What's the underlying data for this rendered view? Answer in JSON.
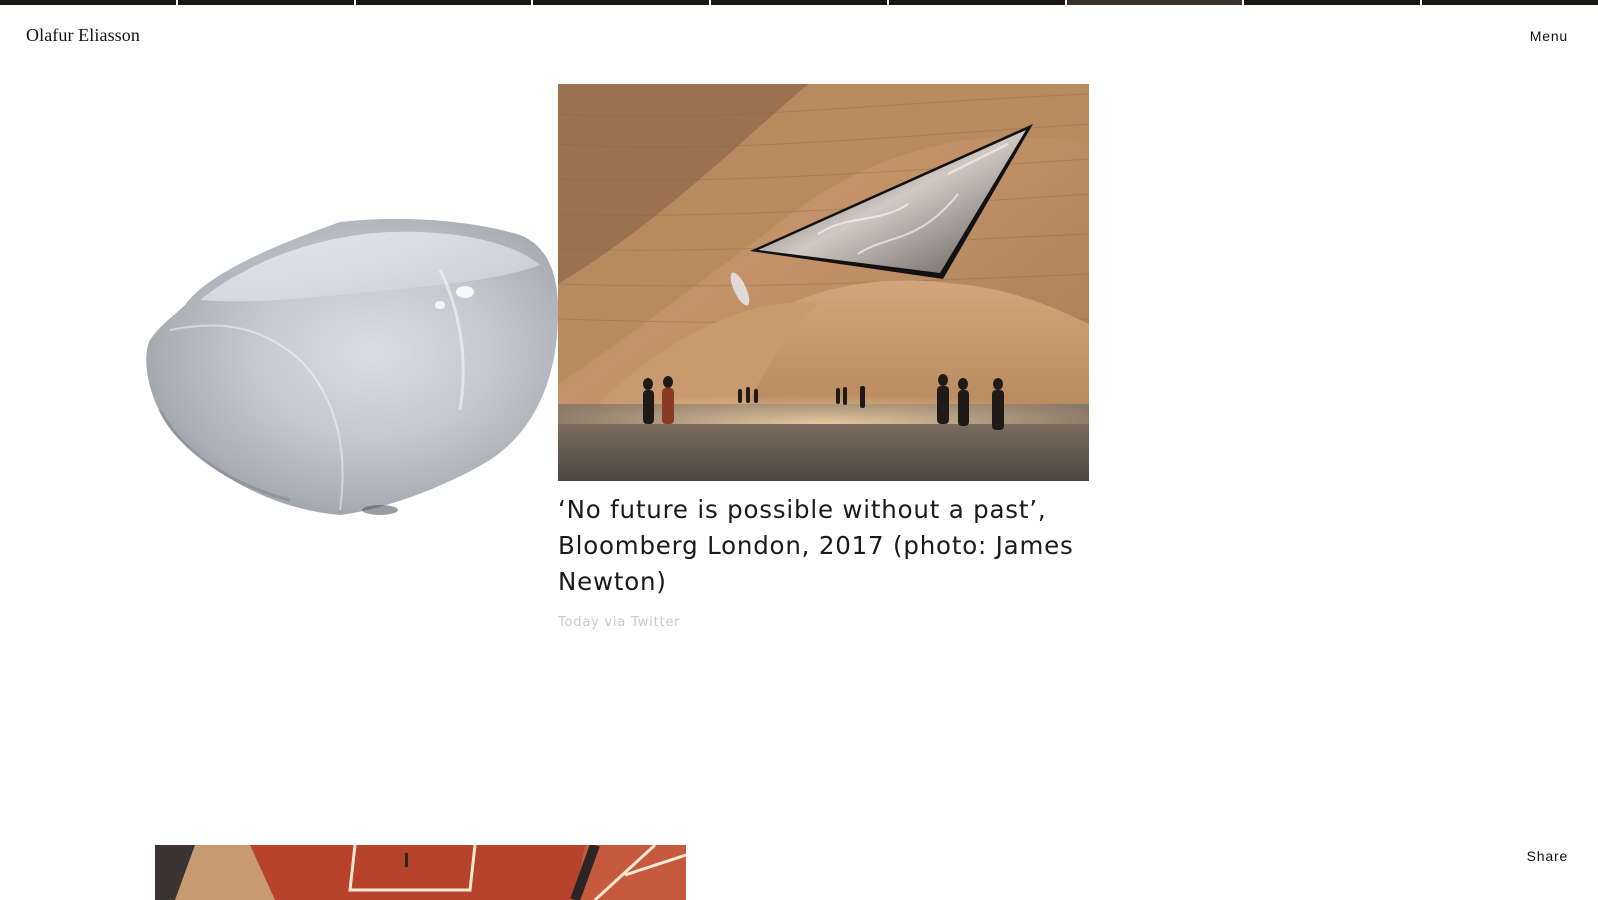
{
  "header": {
    "logo_text": "Olafur Eliasson",
    "menu_label": "Menu"
  },
  "progress": {
    "segment_count": 9,
    "active_index": 6
  },
  "post": {
    "caption": "‘No future is possible without a past’, Bloomberg London, 2017 (photo: James Newton)",
    "meta": "Today via Twitter"
  },
  "footer": {
    "share_label": "Share"
  },
  "colors": {
    "progress_bar": "#1a1614",
    "meta_text": "#c8c8c8",
    "wood": "#b98b5f",
    "red_ceiling": "#b8432c"
  }
}
